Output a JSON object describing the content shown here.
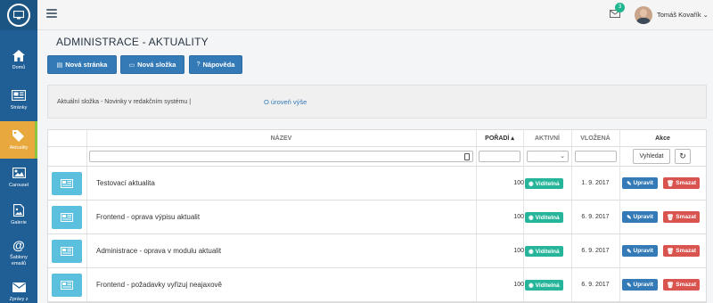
{
  "sidebar": {
    "logo_icon": "monitor-icon",
    "items": [
      {
        "label": "Domů",
        "icon": "home-icon"
      },
      {
        "label": "Stránky",
        "icon": "pages-icon"
      },
      {
        "label": "Aktuality",
        "icon": "tags-icon",
        "active": true
      },
      {
        "label": "Carousel",
        "icon": "image-icon"
      },
      {
        "label": "Galerie",
        "icon": "gallery-icon"
      },
      {
        "label": "Šablony",
        "label2": "emailů",
        "icon": "at-icon"
      },
      {
        "label": "Zprávy z",
        "icon": "envelope-icon"
      }
    ]
  },
  "topbar": {
    "mail_count": "3",
    "user_name": "Tomáš Kovařík ⌄"
  },
  "page": {
    "title": "ADMINISTRACE - AKTUALITY"
  },
  "toolbar": {
    "new_page": "Nová stránka",
    "new_folder": "Nová složka",
    "help": "Nápověda"
  },
  "folder": {
    "text": "Aktuální složka - Novinky v redakčním systému |",
    "up_link": "O úroveň výše"
  },
  "table": {
    "headers": {
      "name": "NÁZEV",
      "order": "POŘADÍ ▴",
      "active": "AKTIVNÍ",
      "inserted": "VLOŽENÁ",
      "actions": "Akce"
    },
    "search_label": "Vyhledat",
    "visible_label": "Viditelná",
    "edit_label": "Upravit",
    "delete_label": "Smazat",
    "rows": [
      {
        "title": "Testovací aktualita",
        "order": "100",
        "date": "1. 9. 2017"
      },
      {
        "title": "Frontend - oprava výpisu aktualit",
        "order": "100",
        "date": "6. 9. 2017"
      },
      {
        "title": "Administrace - oprava v modulu aktualit",
        "order": "100",
        "date": "6. 9. 2017"
      },
      {
        "title": "Frontend - požadavky vyřizuj neajaxově",
        "order": "100",
        "date": "6. 9. 2017"
      }
    ]
  },
  "colors": {
    "sidebar": "#1f5f96",
    "active_item": "#e8a83d",
    "primary": "#337ab7",
    "success": "#26b59a",
    "danger": "#d9534f",
    "info": "#5bc0de"
  }
}
